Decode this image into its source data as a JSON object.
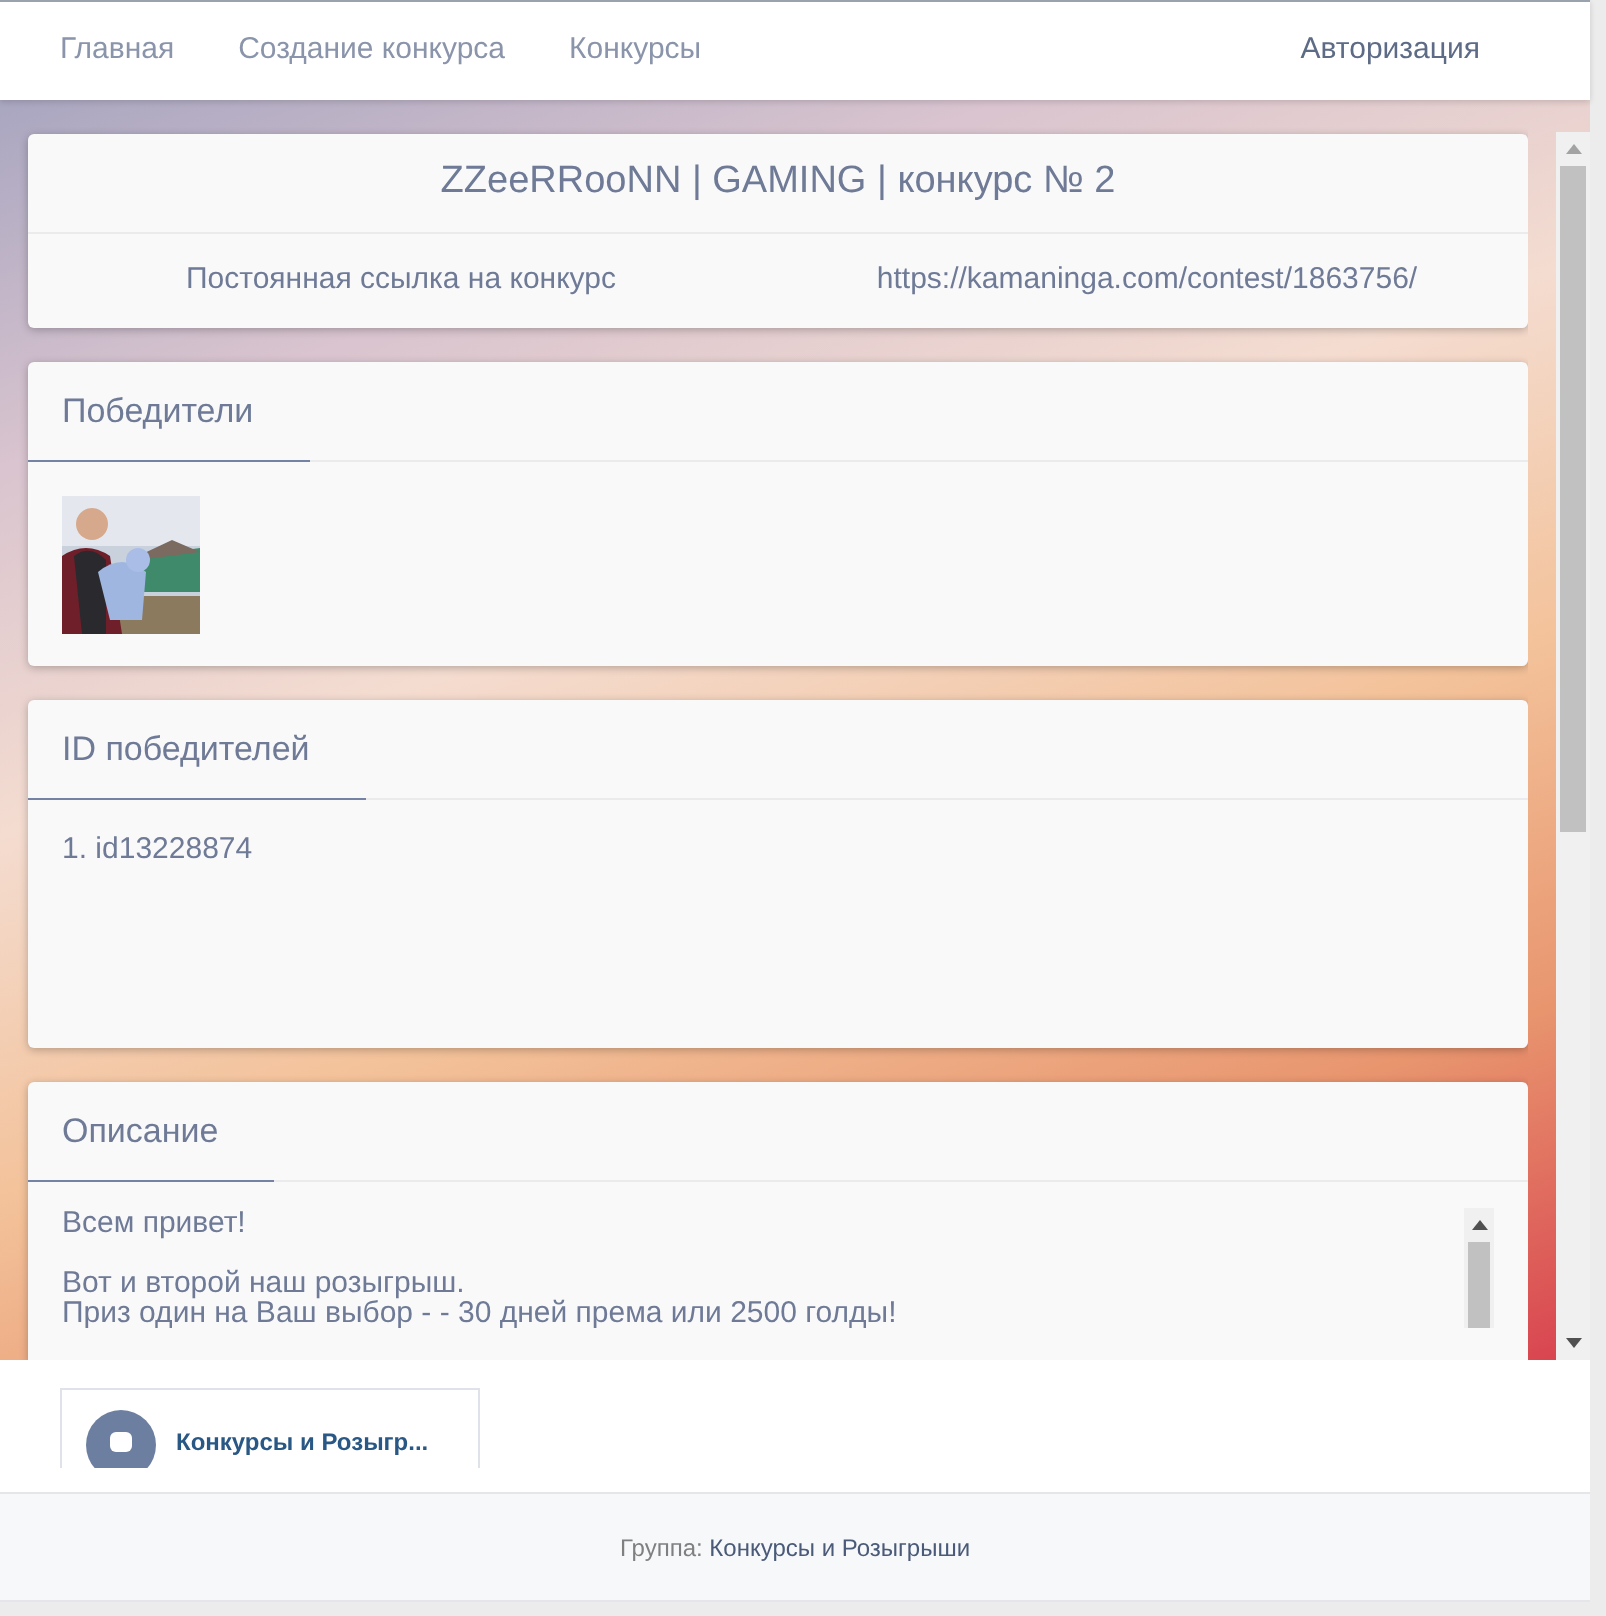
{
  "nav": {
    "links": [
      {
        "label": "Главная"
      },
      {
        "label": "Создание конкурса"
      },
      {
        "label": "Конкурсы"
      }
    ],
    "login": "Авторизация"
  },
  "contest": {
    "title": "ZZeeRRooNN | GAMING | конкурс № 2",
    "link_label": "Постоянная ссылка на конкурс",
    "link_url": "https://kamaninga.com/contest/1863756/"
  },
  "winners": {
    "title": "Победители"
  },
  "winner_ids": {
    "title": "ID победителей",
    "items": [
      "1. id13228874"
    ]
  },
  "description": {
    "title": "Описание",
    "paragraphs": [
      [
        "Всем привет!"
      ],
      [
        "Вот и второй наш розыгрыш.",
        "Приз один на Ваш выбор - - 30 дней према или 2500 голды!"
      ]
    ]
  },
  "widget": {
    "name": "Конкурсы и Розыгр..."
  },
  "footer": {
    "label": "Группа:",
    "group": "Конкурсы и Розыгрыши"
  }
}
